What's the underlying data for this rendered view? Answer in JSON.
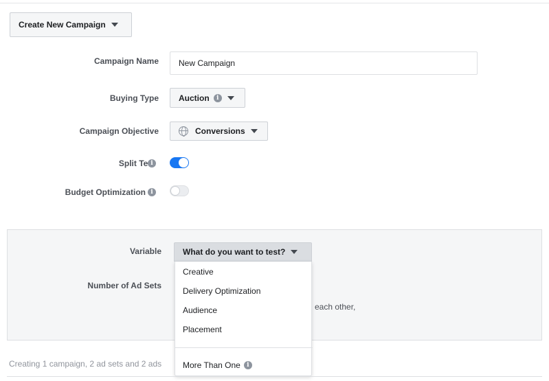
{
  "header": {
    "create_button_label": "Create New Campaign"
  },
  "form": {
    "campaign_name_label": "Campaign Name",
    "campaign_name_value": "New Campaign",
    "buying_type_label": "Buying Type",
    "buying_type_value": "Auction",
    "objective_label": "Campaign Objective",
    "objective_value": "Conversions",
    "split_test_label": "Split Test",
    "split_test_on": true,
    "budget_opt_label": "Budget Optimization",
    "budget_opt_on": false
  },
  "split_test_panel": {
    "variable_label": "Variable",
    "variable_placeholder": "What do you want to test?",
    "num_ad_sets_label": "Number of Ad Sets",
    "partial_text": "each other,",
    "dropdown_options": [
      "Creative",
      "Delivery Optimization",
      "Audience",
      "Placement"
    ],
    "dropdown_more": "More Than One"
  },
  "footer": {
    "summary": "Creating 1 campaign, 2 ad sets and 2 ads"
  },
  "colors": {
    "toggle_on": "#1877f2",
    "info_icon": "#8d949e"
  }
}
